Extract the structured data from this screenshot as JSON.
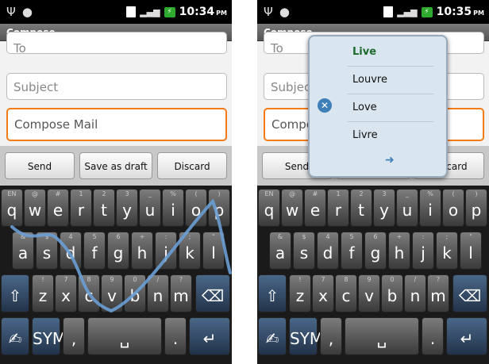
{
  "status_bar": {
    "time": "10:34",
    "ampm": "PM",
    "time_right": "10:35",
    "ampm_right": "PM",
    "battery_glyph": "⚡"
  },
  "compose": {
    "title": "Compose",
    "to_placeholder": "To",
    "subject_placeholder": "Subject",
    "body_placeholder": "Compose Mail"
  },
  "actions": {
    "send": "Send",
    "save_draft": "Save as draft",
    "discard": "Discard"
  },
  "keyboard": {
    "row1": [
      {
        "k": "q",
        "h": "EN"
      },
      {
        "k": "w",
        "h": "@"
      },
      {
        "k": "e",
        "h": "#"
      },
      {
        "k": "r",
        "h": "1"
      },
      {
        "k": "t",
        "h": "2"
      },
      {
        "k": "y",
        "h": "3"
      },
      {
        "k": "u",
        "h": "_"
      },
      {
        "k": "i",
        "h": "%"
      },
      {
        "k": "o",
        "h": "("
      },
      {
        "k": "p",
        "h": ")"
      }
    ],
    "row2": [
      {
        "k": "a",
        "h": "&"
      },
      {
        "k": "s",
        "h": "$"
      },
      {
        "k": "d",
        "h": "4"
      },
      {
        "k": "f",
        "h": "5"
      },
      {
        "k": "g",
        "h": "6"
      },
      {
        "k": "h",
        "h": "+"
      },
      {
        "k": "j",
        "h": ":"
      },
      {
        "k": "k",
        "h": ";"
      },
      {
        "k": "l",
        "h": "\""
      }
    ],
    "row3": [
      {
        "k": "z",
        "h": "!"
      },
      {
        "k": "x",
        "h": "7"
      },
      {
        "k": "c",
        "h": "8"
      },
      {
        "k": "v",
        "h": "9"
      },
      {
        "k": "b",
        "h": "0"
      },
      {
        "k": "n",
        "h": "/"
      },
      {
        "k": "m",
        "h": "?"
      }
    ],
    "sym": "SYM",
    "comma": ",",
    "period": "."
  },
  "suggestions": [
    "Live",
    "Louvre",
    "Love",
    "Livre"
  ],
  "colors": {
    "accent_orange": "#f37b1a",
    "trace_blue": "#6a9fd4",
    "suggest_green": "#1b6b2a"
  }
}
